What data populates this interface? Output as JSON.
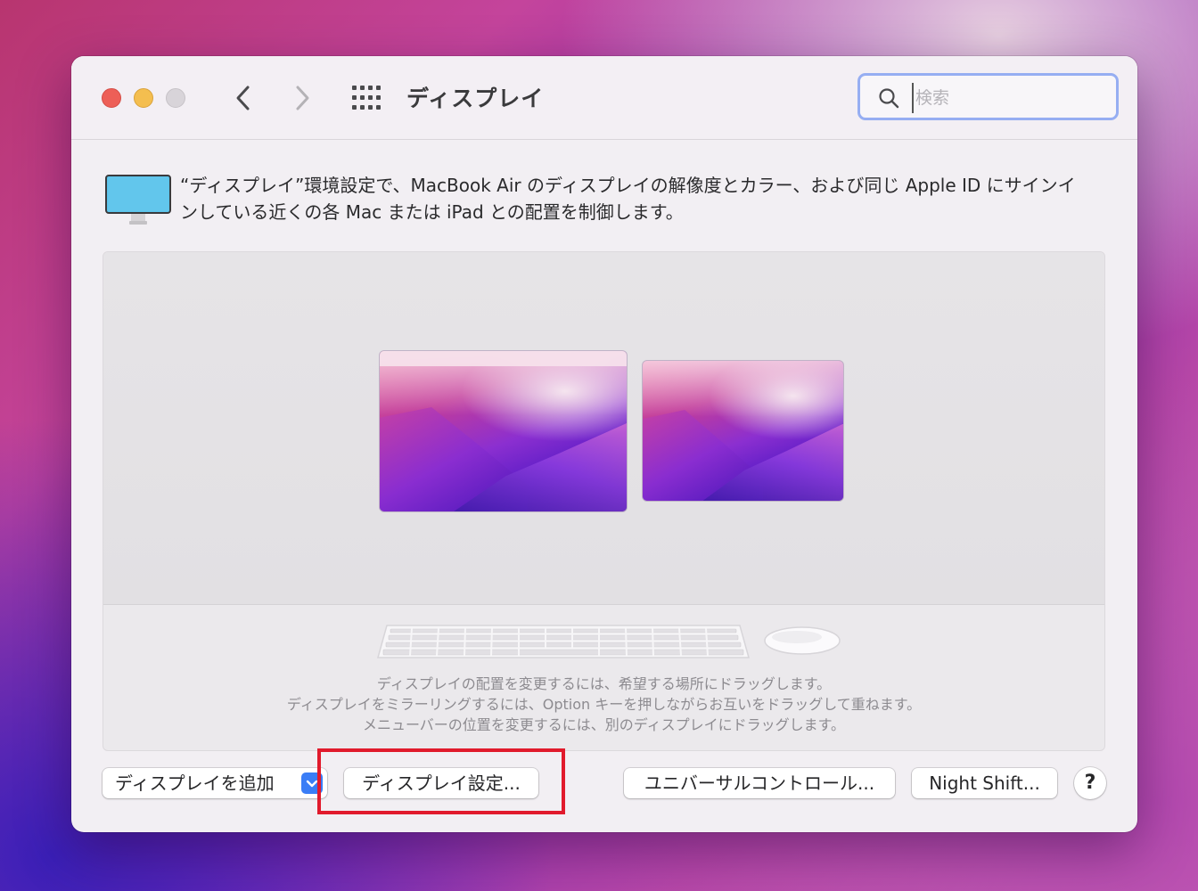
{
  "window": {
    "title": "ディスプレイ",
    "controls": {
      "close": "close-icon",
      "minimize": "minimize-icon",
      "zoom": "zoom-icon"
    },
    "nav": {
      "back": "chevron-left-icon",
      "forward": "chevron-right-icon",
      "show_all": "grid-icon"
    }
  },
  "search": {
    "value": "",
    "placeholder": "検索",
    "icon": "search-icon"
  },
  "description": "“ディスプレイ”環境設定で、MacBook Air のディスプレイの解像度とカラー、および同じ Apple ID にサインインしている近くの各 Mac または iPad との配置を制御します。",
  "arrangement": {
    "displays": [
      {
        "name": "main-display",
        "has_menubar": true
      },
      {
        "name": "secondary-display",
        "has_menubar": false
      }
    ],
    "hints": [
      "ディスプレイの配置を変更するには、希望する場所にドラッグします。",
      "ディスプレイをミラーリングするには、Option キーを押しながらお互いをドラッグして重ねます。",
      "メニューバーの位置を変更するには、別のディスプレイにドラッグします。"
    ]
  },
  "buttons": {
    "add_display": "ディスプレイを追加",
    "display_settings": "ディスプレイ設定...",
    "universal_control": "ユニバーサルコントロール...",
    "night_shift": "Night Shift...",
    "help": "?"
  },
  "colors": {
    "accent": "#3a7df6",
    "search_focus": "#96aef2",
    "highlight": "#e11a2c"
  }
}
